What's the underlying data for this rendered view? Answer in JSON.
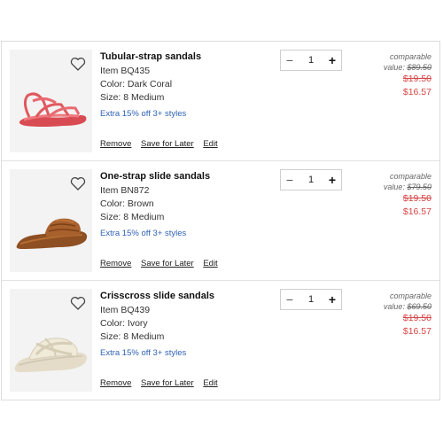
{
  "items": [
    {
      "title": "Tubular-strap sandals",
      "item_code": "Item BQ435",
      "color": "Color: Dark Coral",
      "size": "Size: 8 Medium",
      "promo": "Extra 15% off 3+ styles",
      "quantity": "1",
      "comparable_label": "comparable",
      "value_label": "value:",
      "comparable_value": "$89.50",
      "old_price": "$19.50",
      "sale_price": "$16.57",
      "product_color": "#e0595f"
    },
    {
      "title": "One-strap slide sandals",
      "item_code": "Item BN872",
      "color": "Color: Brown",
      "size": "Size: 8 Medium",
      "promo": "Extra 15% off 3+ styles",
      "quantity": "1",
      "comparable_label": "comparable",
      "value_label": "value:",
      "comparable_value": "$79.50",
      "old_price": "$19.50",
      "sale_price": "$16.57",
      "product_color": "#a8602c"
    },
    {
      "title": "Crisscross slide sandals",
      "item_code": "Item BQ439",
      "color": "Color: Ivory",
      "size": "Size: 8 Medium",
      "promo": "Extra 15% off 3+ styles",
      "quantity": "1",
      "comparable_label": "comparable",
      "value_label": "value:",
      "comparable_value": "$69.50",
      "old_price": "$19.50",
      "sale_price": "$16.57",
      "product_color": "#ede6d6"
    }
  ],
  "actions": {
    "remove": "Remove",
    "save_for_later": "Save for Later",
    "edit": "Edit"
  },
  "stepper": {
    "minus": "−",
    "plus": "+"
  }
}
